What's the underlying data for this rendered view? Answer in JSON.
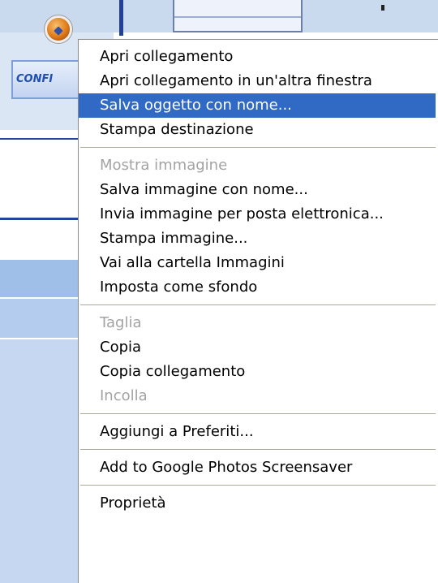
{
  "background": {
    "config_button_label": "CONFI"
  },
  "context_menu": {
    "selected_color": "#316ac5",
    "disabled_color": "#a3a3a3",
    "groups": [
      [
        {
          "label": "Apri collegamento",
          "enabled": true
        },
        {
          "label": "Apri collegamento in un'altra finestra",
          "enabled": true
        },
        {
          "label": "Salva oggetto con nome...",
          "enabled": true,
          "selected": true
        },
        {
          "label": "Stampa destinazione",
          "enabled": true
        }
      ],
      [
        {
          "label": "Mostra immagine",
          "enabled": false
        },
        {
          "label": "Salva immagine con nome...",
          "enabled": true
        },
        {
          "label": "Invia immagine per posta elettronica...",
          "enabled": true
        },
        {
          "label": "Stampa immagine...",
          "enabled": true
        },
        {
          "label": "Vai alla cartella Immagini",
          "enabled": true
        },
        {
          "label": "Imposta come sfondo",
          "enabled": true
        }
      ],
      [
        {
          "label": "Taglia",
          "enabled": false
        },
        {
          "label": "Copia",
          "enabled": true
        },
        {
          "label": "Copia collegamento",
          "enabled": true
        },
        {
          "label": "Incolla",
          "enabled": false
        }
      ],
      [
        {
          "label": "Aggiungi a Preferiti...",
          "enabled": true
        }
      ],
      [
        {
          "label": "Add to Google Photos Screensaver",
          "enabled": true
        }
      ],
      [
        {
          "label": "Proprietà",
          "enabled": true
        }
      ]
    ]
  }
}
